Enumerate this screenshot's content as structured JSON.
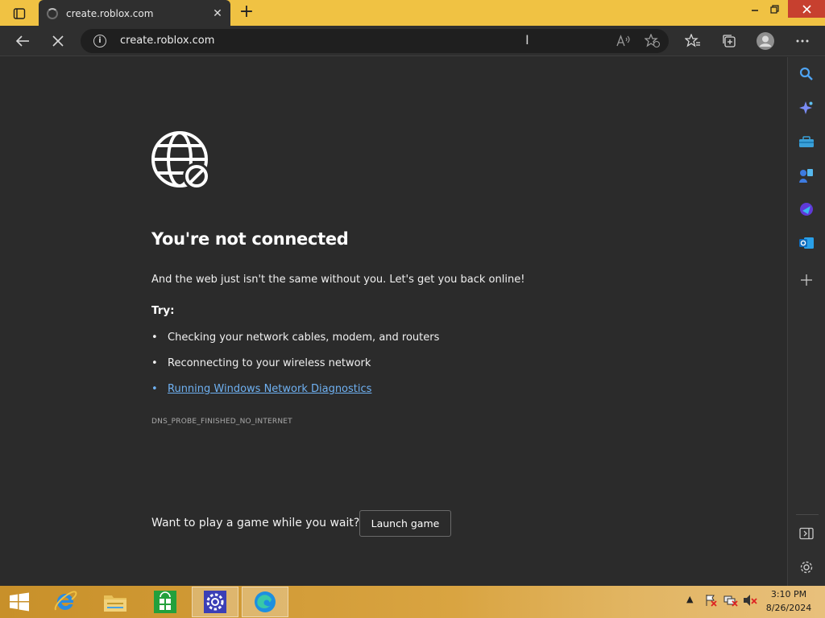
{
  "browser": {
    "tab": {
      "title": "create.roblox.com",
      "loading": true
    },
    "address": {
      "url": "create.roblox.com"
    }
  },
  "page": {
    "title": "You're not connected",
    "description": "And the web just isn't the same without you. Let's get you back online!",
    "try_label": "Try:",
    "suggestions": [
      {
        "text": "Checking your network cables, modem, and routers",
        "link": false
      },
      {
        "text": "Reconnecting to your wireless network",
        "link": false
      },
      {
        "text": "Running Windows Network Diagnostics",
        "link": true
      }
    ],
    "error_code": "DNS_PROBE_FINISHED_NO_INTERNET",
    "game_prompt": "Want to play a game while you wait?",
    "launch_button": "Launch game"
  },
  "sidebar": {
    "items": [
      "search-icon",
      "copilot-icon",
      "tools-icon",
      "games-icon",
      "designer-icon",
      "outlook-icon",
      "add-icon"
    ],
    "bottom": [
      "hide-sidebar-icon",
      "settings-icon"
    ]
  },
  "taskbar": {
    "items": [
      "start-button",
      "internet-explorer",
      "file-explorer",
      "store",
      "settings",
      "edge"
    ],
    "active": "edge",
    "clock": {
      "time": "3:10 PM",
      "date": "8/26/2024"
    }
  },
  "colors": {
    "titlebar": "#f0c243",
    "page_bg": "#2b2b2b",
    "link": "#6fb1f2",
    "close_button": "#c7402f"
  }
}
